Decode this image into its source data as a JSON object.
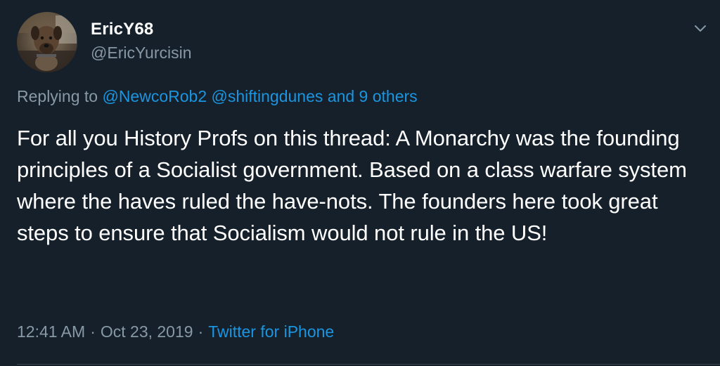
{
  "user": {
    "display_name": "EricY68",
    "handle": "@EricYurcisin"
  },
  "reply": {
    "prefix": "Replying to",
    "mention_1": "@NewcoRob2",
    "mention_2": "@shiftingdunes",
    "and": "and",
    "others": "9 others"
  },
  "tweet": {
    "text": "For all you History Profs on this thread: A Monarchy was the founding principles of a Socialist government. Based on a class warfare system where the haves ruled the have-nots. The founders here took great steps to ensure that Socialism would not rule in the US!"
  },
  "meta": {
    "time": "12:41 AM",
    "separator": "·",
    "date": "Oct 23, 2019",
    "source": "Twitter for iPhone"
  },
  "icons": {
    "menu": "chevron-down-icon",
    "avatar": "avatar-photo"
  },
  "colors": {
    "background": "#15202b",
    "text_primary": "#ffffff",
    "text_secondary": "#8899a6",
    "link": "#1b95e0"
  }
}
